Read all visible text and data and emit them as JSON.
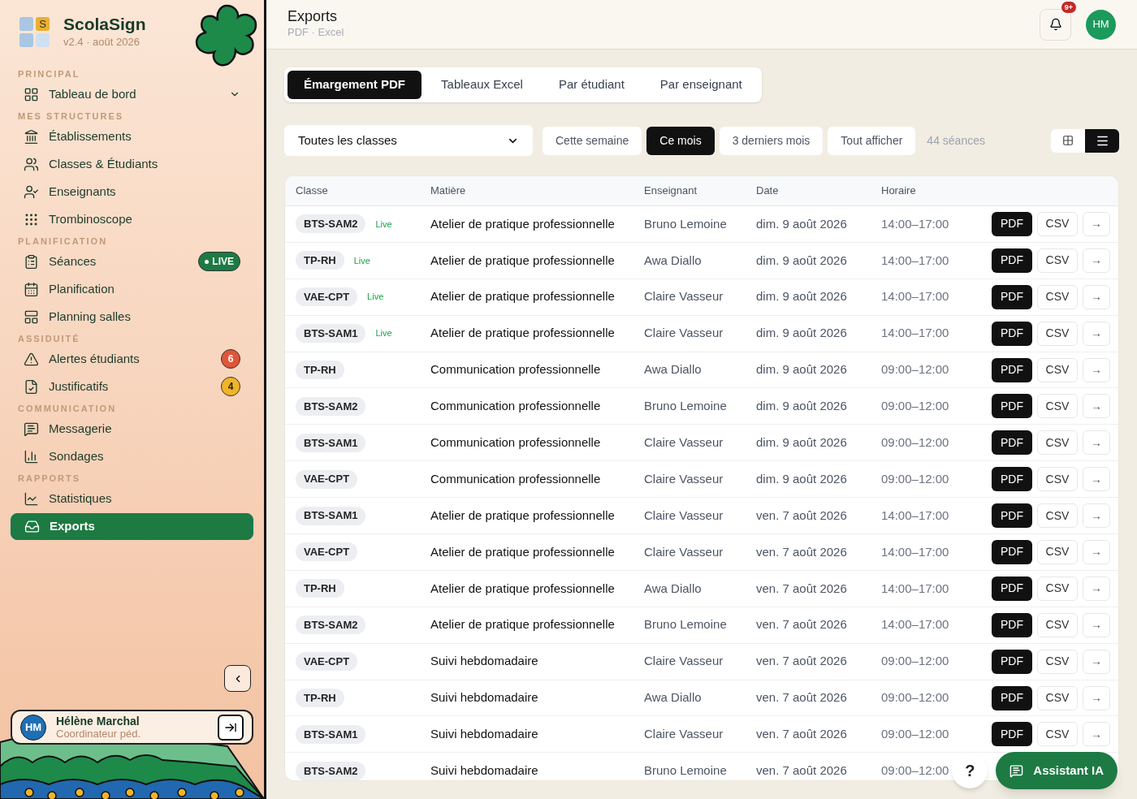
{
  "brand": {
    "logo_letter": "S",
    "name": "ScolaSign",
    "version": "v2.4 · août 2026"
  },
  "sidebar": {
    "sections": [
      {
        "title": "PRINCIPAL",
        "items": [
          {
            "label": "Tableau de bord",
            "selected": false
          }
        ]
      },
      {
        "title": "MES STRUCTURES",
        "items": [
          {
            "label": "Établissements",
            "selected": false
          },
          {
            "label": "Classes & Étudiants",
            "selected": false
          },
          {
            "label": "Enseignants",
            "selected": false
          },
          {
            "label": "Trombinoscope",
            "selected": false
          }
        ]
      },
      {
        "title": "PLANIFICATION",
        "items": [
          {
            "label": "Séances",
            "selected": false,
            "badge": "LIVE",
            "color": "#1d7a43"
          },
          {
            "label": "Planification",
            "selected": false
          },
          {
            "label": "Planning salles",
            "selected": false
          }
        ]
      },
      {
        "title": "ASSIDUITÉ",
        "items": [
          {
            "label": "Alertes étudiants",
            "selected": false,
            "badge": "6",
            "color": "#e0553a"
          },
          {
            "label": "Justificatifs",
            "selected": false,
            "badge": "4",
            "color": "#f0b429"
          }
        ]
      },
      {
        "title": "COMMUNICATION",
        "items": [
          {
            "label": "Messagerie",
            "selected": false
          },
          {
            "label": "Sondages",
            "selected": false
          }
        ]
      },
      {
        "title": "RAPPORTS",
        "items": [
          {
            "label": "Statistiques",
            "selected": false
          },
          {
            "label": "Exports",
            "selected": true
          }
        ]
      }
    ]
  },
  "user": {
    "initials": "HM",
    "name": "Hélène Marchal",
    "role": "Coordinateur péd."
  },
  "header": {
    "title": "Exports",
    "subtitle": "PDF · Excel",
    "notifications": "9+",
    "avatar": "HM"
  },
  "tabs": [
    {
      "label": "Émargement PDF",
      "selected": true
    },
    {
      "label": "Tableaux Excel",
      "selected": false
    },
    {
      "label": "Par étudiant",
      "selected": false
    },
    {
      "label": "Par enseignant",
      "selected": false
    }
  ],
  "filters": {
    "class_select": "Toutes les classes",
    "periods": [
      {
        "label": "Cette semaine",
        "selected": false
      },
      {
        "label": "Ce mois",
        "selected": true
      },
      {
        "label": "3 derniers mois",
        "selected": false
      },
      {
        "label": "Tout afficher",
        "selected": false
      }
    ],
    "count": "44 séances",
    "view": [
      {
        "kind": "grid",
        "selected": false
      },
      {
        "kind": "list",
        "selected": true
      }
    ]
  },
  "table": {
    "columns": [
      "Classe",
      "Matière",
      "Enseignant",
      "Date",
      "Horaire"
    ],
    "rows": [
      {
        "classe": "BTS-SAM2",
        "live": "Live",
        "matiere": "Atelier de pratique professionnelle",
        "enseignant": "Bruno Lemoine",
        "date": "dim. 9 août 2026",
        "horaire": "14:00–17:00",
        "actions": [
          "PDF",
          "CSV",
          "→"
        ]
      },
      {
        "classe": "TP-RH",
        "live": "Live",
        "matiere": "Atelier de pratique professionnelle",
        "enseignant": "Awa Diallo",
        "date": "dim. 9 août 2026",
        "horaire": "14:00–17:00",
        "actions": [
          "PDF",
          "CSV",
          "→"
        ]
      },
      {
        "classe": "VAE-CPT",
        "live": "Live",
        "matiere": "Atelier de pratique professionnelle",
        "enseignant": "Claire Vasseur",
        "date": "dim. 9 août 2026",
        "horaire": "14:00–17:00",
        "actions": [
          "PDF",
          "CSV",
          "→"
        ]
      },
      {
        "classe": "BTS-SAM1",
        "live": "Live",
        "matiere": "Atelier de pratique professionnelle",
        "enseignant": "Claire Vasseur",
        "date": "dim. 9 août 2026",
        "horaire": "14:00–17:00",
        "actions": [
          "PDF",
          "CSV",
          "→"
        ]
      },
      {
        "classe": "TP-RH",
        "matiere": "Communication professionnelle",
        "enseignant": "Awa Diallo",
        "date": "dim. 9 août 2026",
        "horaire": "09:00–12:00",
        "actions": [
          "PDF",
          "CSV",
          "→"
        ]
      },
      {
        "classe": "BTS-SAM2",
        "matiere": "Communication professionnelle",
        "enseignant": "Bruno Lemoine",
        "date": "dim. 9 août 2026",
        "horaire": "09:00–12:00",
        "actions": [
          "PDF",
          "CSV",
          "→"
        ]
      },
      {
        "classe": "BTS-SAM1",
        "matiere": "Communication professionnelle",
        "enseignant": "Claire Vasseur",
        "date": "dim. 9 août 2026",
        "horaire": "09:00–12:00",
        "actions": [
          "PDF",
          "CSV",
          "→"
        ]
      },
      {
        "classe": "VAE-CPT",
        "matiere": "Communication professionnelle",
        "enseignant": "Claire Vasseur",
        "date": "dim. 9 août 2026",
        "horaire": "09:00–12:00",
        "actions": [
          "PDF",
          "CSV",
          "→"
        ]
      },
      {
        "classe": "BTS-SAM1",
        "matiere": "Atelier de pratique professionnelle",
        "enseignant": "Claire Vasseur",
        "date": "ven. 7 août 2026",
        "horaire": "14:00–17:00",
        "actions": [
          "PDF",
          "CSV",
          "→"
        ]
      },
      {
        "classe": "VAE-CPT",
        "matiere": "Atelier de pratique professionnelle",
        "enseignant": "Claire Vasseur",
        "date": "ven. 7 août 2026",
        "horaire": "14:00–17:00",
        "actions": [
          "PDF",
          "CSV",
          "→"
        ]
      },
      {
        "classe": "TP-RH",
        "matiere": "Atelier de pratique professionnelle",
        "enseignant": "Awa Diallo",
        "date": "ven. 7 août 2026",
        "horaire": "14:00–17:00",
        "actions": [
          "PDF",
          "CSV",
          "→"
        ]
      },
      {
        "classe": "BTS-SAM2",
        "matiere": "Atelier de pratique professionnelle",
        "enseignant": "Bruno Lemoine",
        "date": "ven. 7 août 2026",
        "horaire": "14:00–17:00",
        "actions": [
          "PDF",
          "CSV",
          "→"
        ]
      },
      {
        "classe": "VAE-CPT",
        "matiere": "Suivi hebdomadaire",
        "enseignant": "Claire Vasseur",
        "date": "ven. 7 août 2026",
        "horaire": "09:00–12:00",
        "actions": [
          "PDF",
          "CSV",
          "→"
        ]
      },
      {
        "classe": "TP-RH",
        "matiere": "Suivi hebdomadaire",
        "enseignant": "Awa Diallo",
        "date": "ven. 7 août 2026",
        "horaire": "09:00–12:00",
        "actions": [
          "PDF",
          "CSV",
          "→"
        ]
      },
      {
        "classe": "BTS-SAM1",
        "matiere": "Suivi hebdomadaire",
        "enseignant": "Claire Vasseur",
        "date": "ven. 7 août 2026",
        "horaire": "09:00–12:00",
        "actions": [
          "PDF",
          "CSV",
          "→"
        ]
      },
      {
        "classe": "BTS-SAM2",
        "matiere": "Suivi hebdomadaire",
        "enseignant": "Bruno Lemoine",
        "date": "ven. 7 août 2026",
        "horaire": "09:00–12:00"
      }
    ]
  },
  "floating": {
    "help": "?",
    "assistant": "Assistant IA"
  }
}
